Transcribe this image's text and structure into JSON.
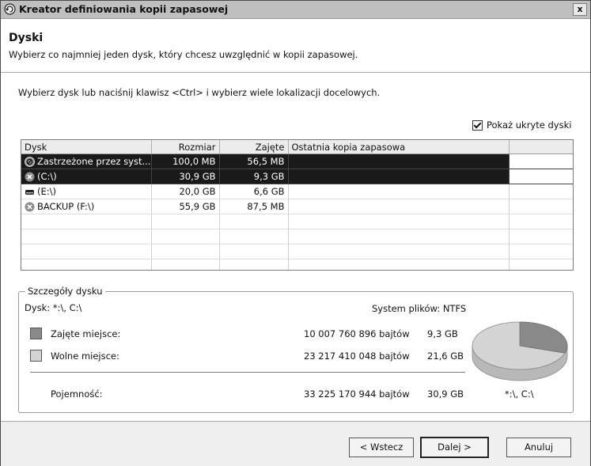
{
  "window": {
    "title": "Kreator definiowania kopii zapasowej",
    "close_label": "x"
  },
  "header": {
    "title": "Dyski",
    "subtitle": "Wybierz co najmniej jeden dysk, który chcesz uwzględnić w kopii zapasowej."
  },
  "instruction": "Wybierz dysk lub naciśnij klawisz <Ctrl> i wybierz wiele lokalizacji docelowych.",
  "show_hidden": {
    "label": "Pokaż ukryte dyski",
    "checked": true
  },
  "table": {
    "columns": [
      "Dysk",
      "Rozmiar",
      "Zajęte",
      "Ostatnia kopia zapasowa"
    ],
    "rows": [
      {
        "disk": "Zastrzeżone przez syst...",
        "size": "100,0 MB",
        "used": "56,5 MB",
        "last_backup": "",
        "icon": "reserved-disk-icon",
        "selected": true
      },
      {
        "disk": "(C:\\)",
        "size": "30,9 GB",
        "used": "9,3 GB",
        "last_backup": "",
        "icon": "disk-error-icon",
        "selected": true
      },
      {
        "disk": "(E:\\)",
        "size": "20,0 GB",
        "used": "6,6 GB",
        "last_backup": "",
        "icon": "hard-drive-icon",
        "selected": false
      },
      {
        "disk": "BACKUP (F:\\)",
        "size": "55,9 GB",
        "used": "87,5 MB",
        "last_backup": "",
        "icon": "disk-error-icon",
        "selected": false
      }
    ]
  },
  "details": {
    "title": "Szczegóły dysku",
    "disk_label": "Dysk: *:\\, C:\\",
    "filesystem_label": "System plików: NTFS",
    "used": {
      "label": "Zajęte miejsce:",
      "bytes": "10 007 760 896 bajtów",
      "size": "9,3 GB",
      "color": "#8a8a8a"
    },
    "free": {
      "label": "Wolne miejsce:",
      "bytes": "23 217 410 048 bajtów",
      "size": "21,6 GB",
      "color": "#d4d4d4"
    },
    "capacity": {
      "label": "Pojemność:",
      "bytes": "33 225 170 944 bajtów",
      "size": "30,9 GB"
    },
    "pie_label": "*:\\, C:\\",
    "used_fraction": 0.3
  },
  "buttons": {
    "back": "< Wstecz",
    "next": "Dalej >",
    "cancel": "Anuluj"
  }
}
